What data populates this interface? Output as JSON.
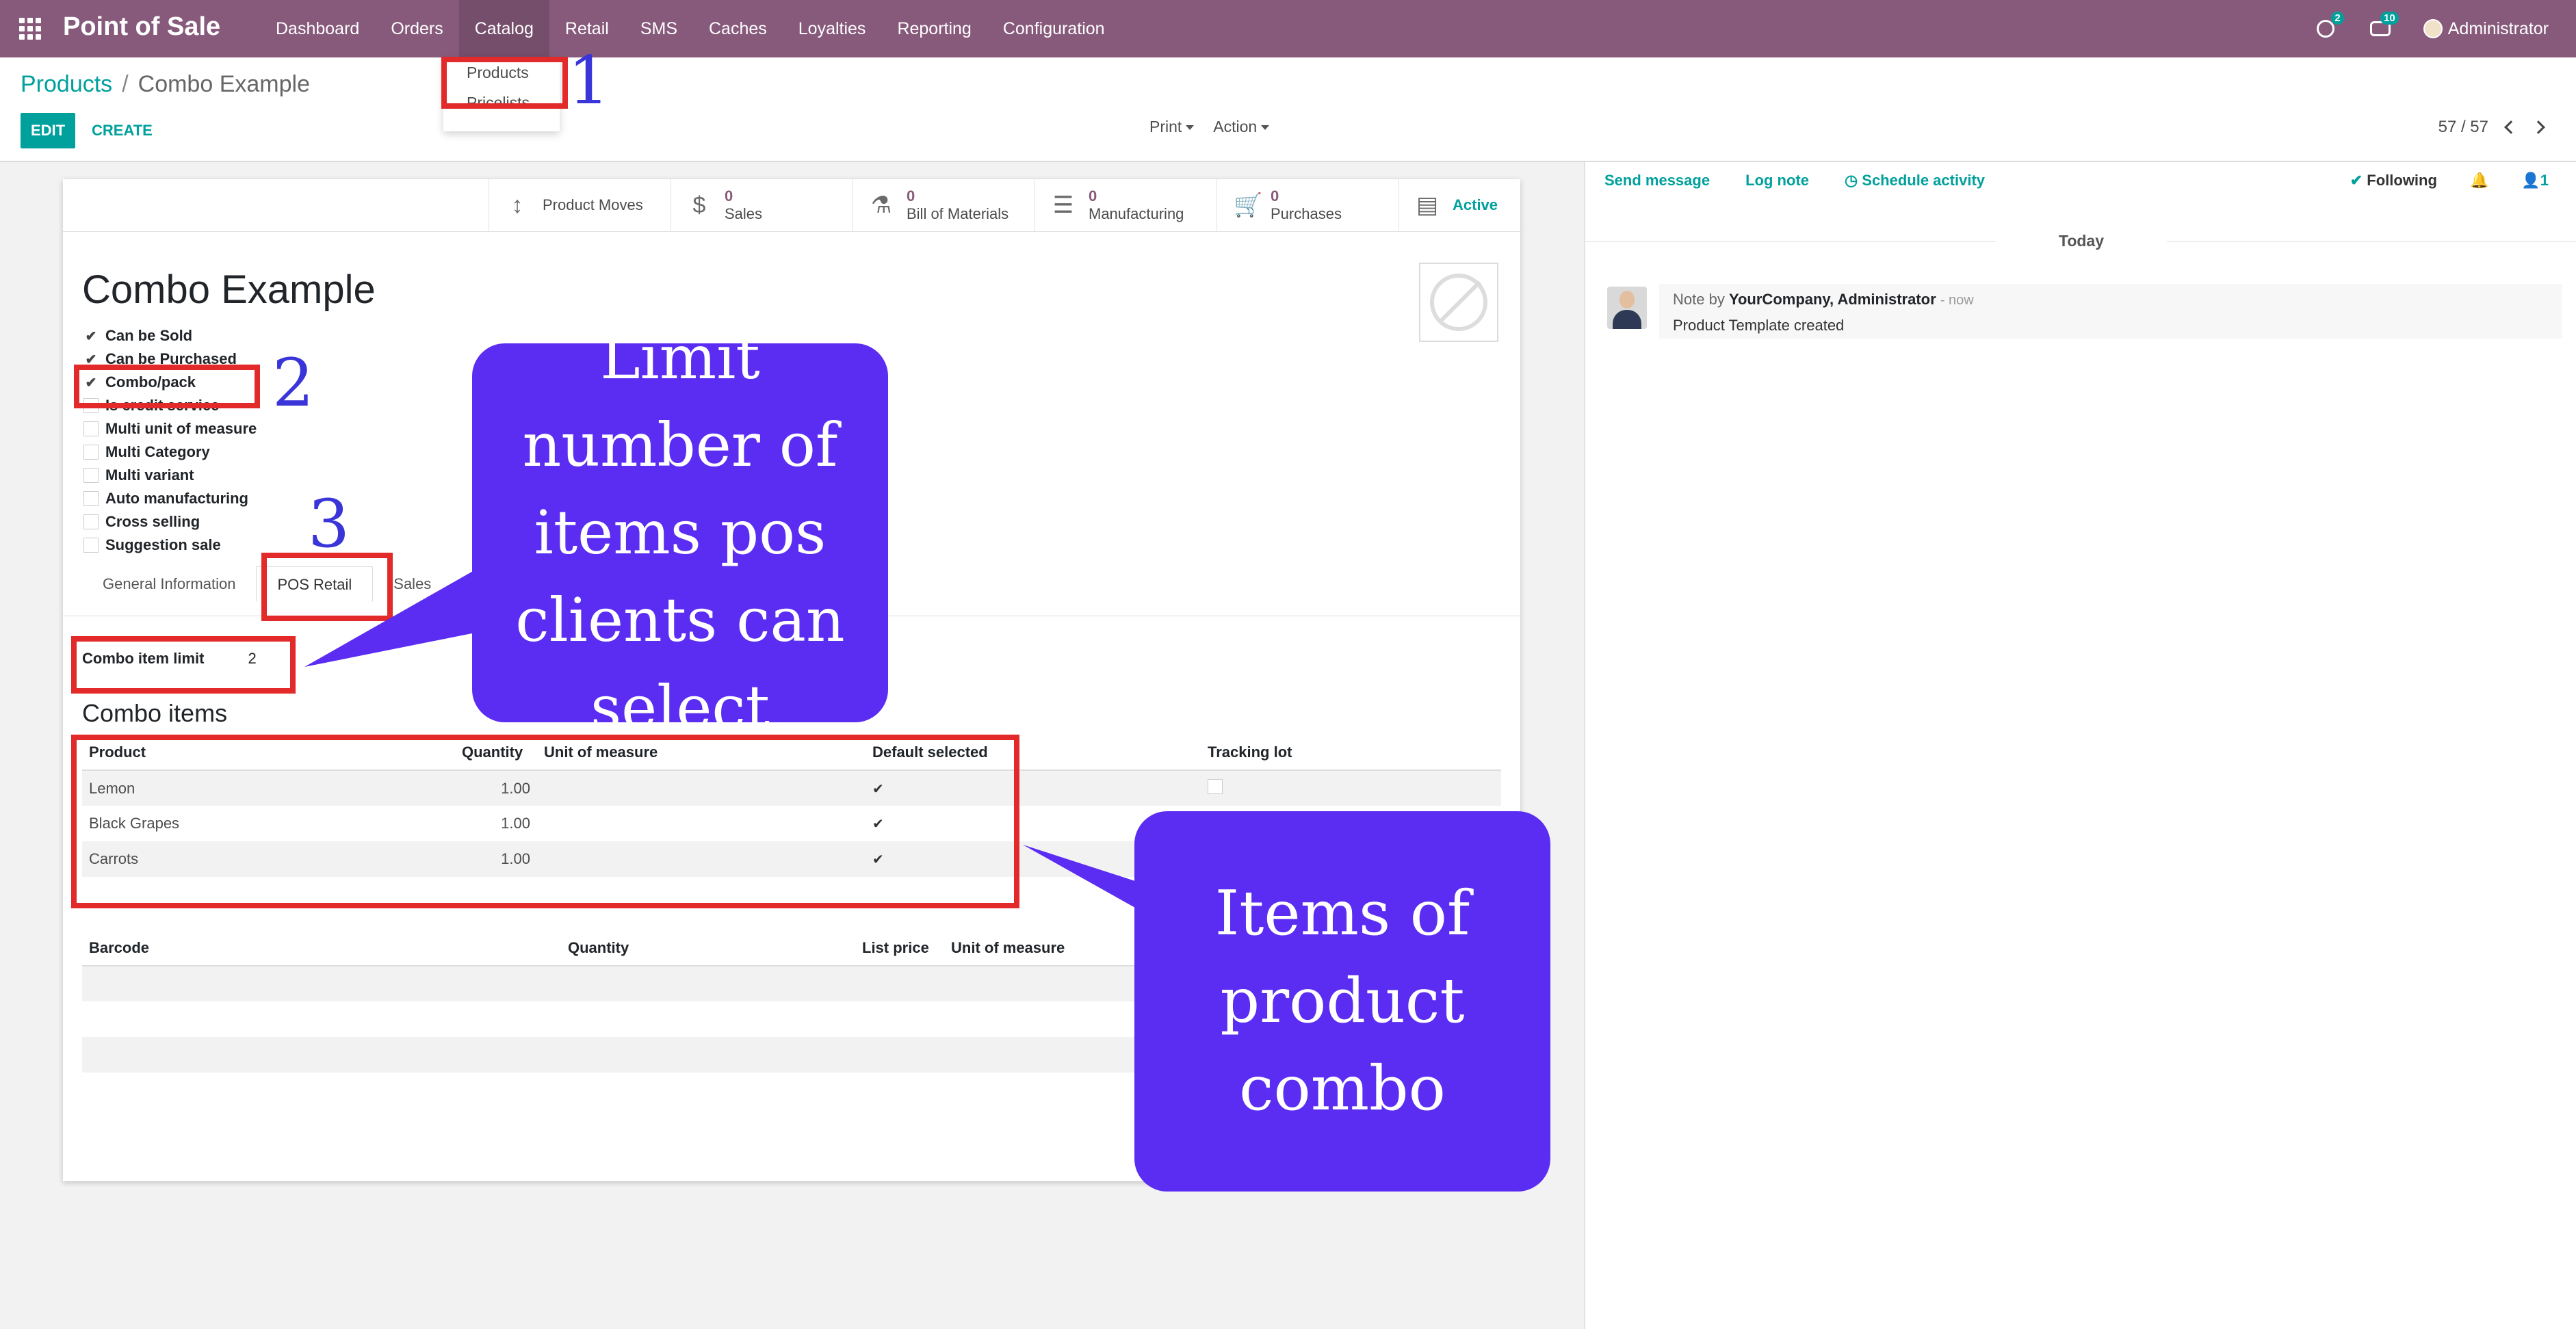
{
  "navbar": {
    "brand": "Point of Sale",
    "menu": [
      "Dashboard",
      "Orders",
      "Catalog",
      "Retail",
      "SMS",
      "Caches",
      "Loyalties",
      "Reporting",
      "Configuration"
    ],
    "activities_count": "2",
    "messages_count": "10",
    "user": "Administrator"
  },
  "catalog_dropdown": {
    "items": [
      "Products",
      "Pricelists"
    ]
  },
  "breadcrumb": {
    "parent": "Products",
    "separator": "/",
    "current": "Combo Example"
  },
  "buttons": {
    "edit": "EDIT",
    "create": "CREATE",
    "print": "Print",
    "action": "Action"
  },
  "pager": "57 / 57",
  "smart_buttons": {
    "product_moves": "Product Moves",
    "sales_count": "0",
    "sales": "Sales",
    "bom_count": "0",
    "bom": "Bill of Materials",
    "manufacturing_count": "0",
    "manufacturing": "Manufacturing",
    "purchases_count": "0",
    "purchases": "Purchases",
    "active": "Active"
  },
  "product": {
    "name": "Combo Example",
    "options": [
      {
        "label": "Can be Sold",
        "checked": true
      },
      {
        "label": "Can be Purchased",
        "checked": true
      },
      {
        "label": "Combo/pack",
        "checked": true
      },
      {
        "label": "Is credit service",
        "checked": false
      },
      {
        "label": "Multi unit of measure",
        "checked": false
      },
      {
        "label": "Multi Category",
        "checked": false
      },
      {
        "label": "Multi variant",
        "checked": false
      },
      {
        "label": "Auto manufacturing",
        "checked": false
      },
      {
        "label": "Cross selling",
        "checked": false
      },
      {
        "label": "Suggestion sale",
        "checked": false
      }
    ]
  },
  "tabs": [
    "General Information",
    "POS Retail",
    "Sales"
  ],
  "combo_limit": {
    "label": "Combo item limit",
    "value": "2"
  },
  "combo_items": {
    "title": "Combo items",
    "headers": [
      "Product",
      "Quantity",
      "Unit of measure",
      "Default selected",
      "Tracking lot"
    ],
    "rows": [
      {
        "product": "Lemon",
        "quantity": "1.00",
        "default_selected": true
      },
      {
        "product": "Black Grapes",
        "quantity": "1.00",
        "default_selected": true
      },
      {
        "product": "Carrots",
        "quantity": "1.00",
        "default_selected": true
      }
    ]
  },
  "barcode_table": {
    "headers": [
      "Barcode",
      "Quantity",
      "List price",
      "Unit of measure"
    ]
  },
  "chatter": {
    "send_message": "Send message",
    "log_note": "Log note",
    "schedule_activity": "Schedule activity",
    "following": "Following",
    "followers_count": "1",
    "today": "Today",
    "message": {
      "prefix": "Note by",
      "author": "YourCompany, Administrator",
      "time": "- now",
      "body": "Product Template created"
    }
  },
  "annotations": {
    "n1": "1",
    "n2": "2",
    "n3": "3",
    "bubble_limit": "Limit number of items pos clients can select",
    "bubble_items": "Items of product combo"
  }
}
